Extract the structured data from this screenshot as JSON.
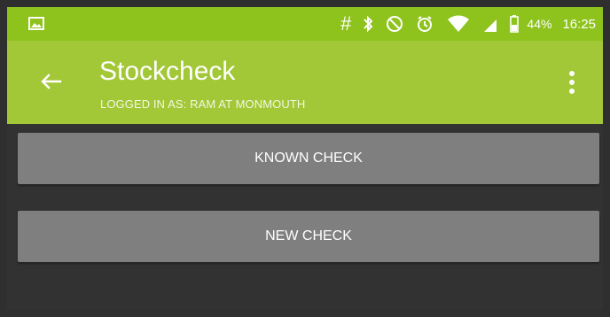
{
  "status_bar": {
    "battery_percent": "44%",
    "time": "16:25",
    "icons": [
      "image-icon",
      "hash-icon",
      "bluetooth-icon",
      "do-not-disturb-icon",
      "alarm-icon",
      "wifi-icon",
      "signal-icon",
      "battery-icon"
    ]
  },
  "app_bar": {
    "title": "Stockcheck",
    "subtitle": "LOGGED IN AS: RAM AT MONMOUTH",
    "background_color": "#a2c737",
    "status_color": "#8dc31c"
  },
  "actions": {
    "known_check_label": "KNOWN CHECK",
    "new_check_label": "NEW CHECK"
  }
}
